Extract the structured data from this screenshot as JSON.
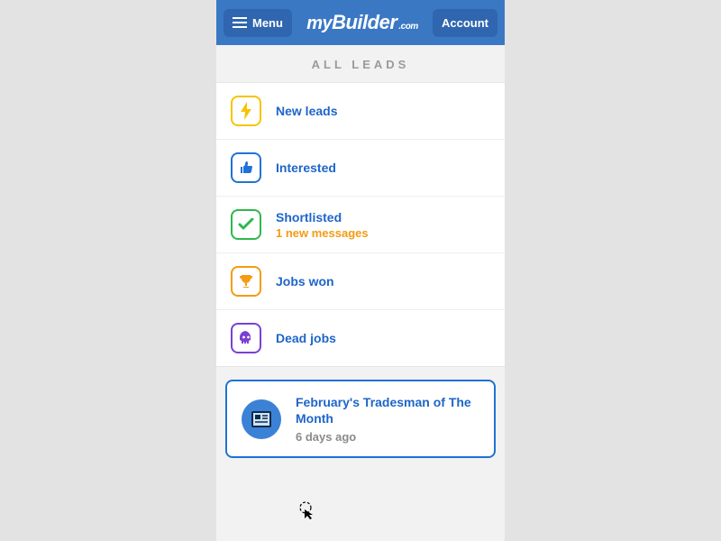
{
  "header": {
    "menu_label": "Menu",
    "account_label": "Account",
    "logo": {
      "my": "my",
      "builder": "Builder",
      "suffix": ".com"
    }
  },
  "section_title": "ALL LEADS",
  "leads": [
    {
      "label": "New leads",
      "sub": null
    },
    {
      "label": "Interested",
      "sub": null
    },
    {
      "label": "Shortlisted",
      "sub": "1 new messages"
    },
    {
      "label": "Jobs won",
      "sub": null
    },
    {
      "label": "Dead jobs",
      "sub": null
    }
  ],
  "news_card": {
    "title": "February's Tradesman of The Month",
    "time": "6 days ago"
  }
}
